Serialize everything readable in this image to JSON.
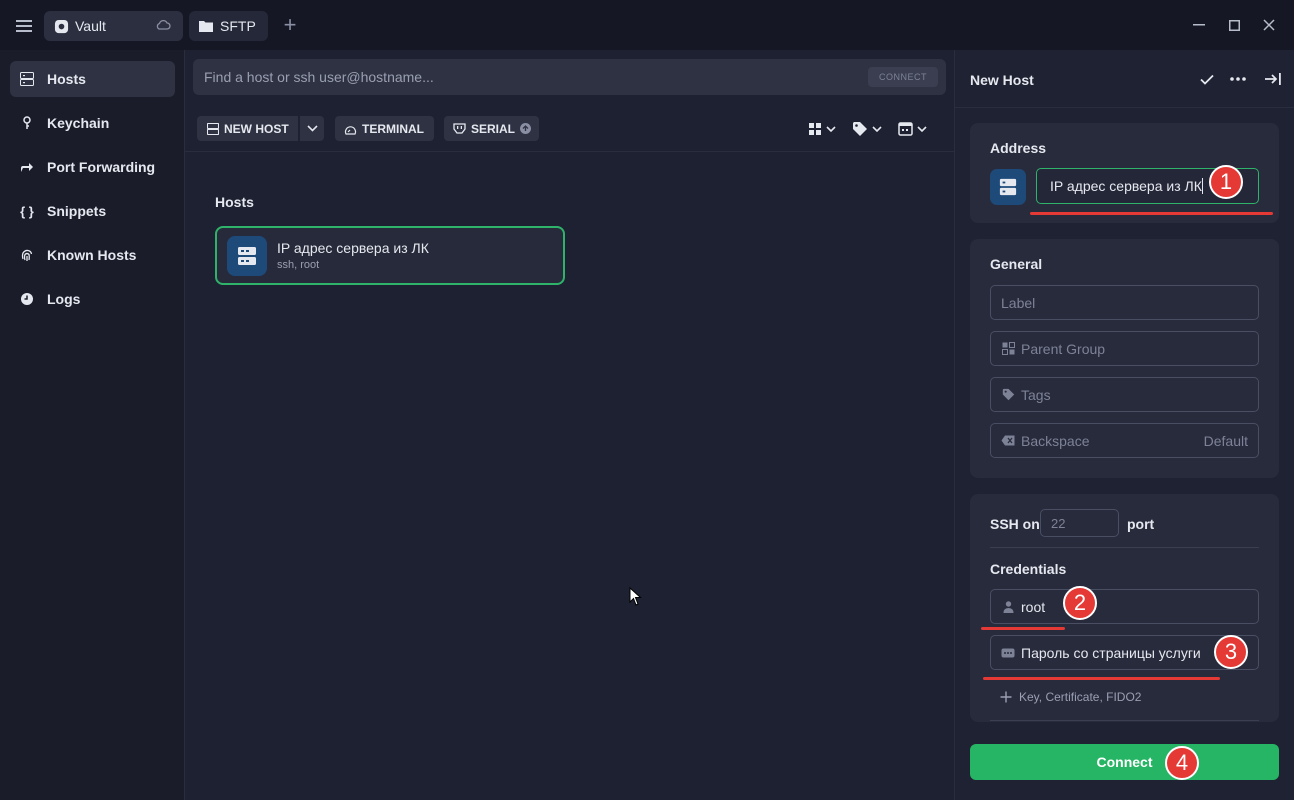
{
  "tabs": [
    {
      "label": "Vault",
      "icon": "vault-icon"
    },
    {
      "label": "SFTP",
      "icon": "folder-icon"
    }
  ],
  "sidebar": {
    "items": [
      {
        "label": "Hosts",
        "icon": "hosts-icon",
        "active": true
      },
      {
        "label": "Keychain",
        "icon": "key-icon"
      },
      {
        "label": "Port Forwarding",
        "icon": "forward-icon"
      },
      {
        "label": "Snippets",
        "icon": "braces-icon"
      },
      {
        "label": "Known Hosts",
        "icon": "fingerprint-icon"
      },
      {
        "label": "Logs",
        "icon": "clock-icon"
      }
    ]
  },
  "search": {
    "placeholder": "Find a host or ssh user@hostname...",
    "connect_label": "CONNECT"
  },
  "toolbar": {
    "new_host": "NEW HOST",
    "terminal": "TERMINAL",
    "serial": "SERIAL"
  },
  "hosts_section": {
    "title": "Hosts",
    "items": [
      {
        "name": "IP адрес сервера из ЛК",
        "subtitle": "ssh, root"
      }
    ]
  },
  "panel": {
    "title": "New Host",
    "address": {
      "heading": "Address",
      "value": "IP адрес сервера из ЛК"
    },
    "general": {
      "heading": "General",
      "label_placeholder": "Label",
      "parent_group_placeholder": "Parent Group",
      "tags_placeholder": "Tags",
      "backspace_label": "Backspace",
      "backspace_value": "Default"
    },
    "ssh": {
      "prefix": "SSH on",
      "port_placeholder": "22",
      "suffix": "port"
    },
    "credentials": {
      "heading": "Credentials",
      "username": "root",
      "password": "Пароль со страницы услуги",
      "add_key": "Key, Certificate, FIDO2"
    },
    "connect_label": "Connect"
  },
  "annotations": [
    "1",
    "2",
    "3",
    "4"
  ],
  "colors": {
    "accent_green": "#26b565",
    "annotation_red": "#e53935",
    "host_avatar": "#1e4a7a"
  }
}
